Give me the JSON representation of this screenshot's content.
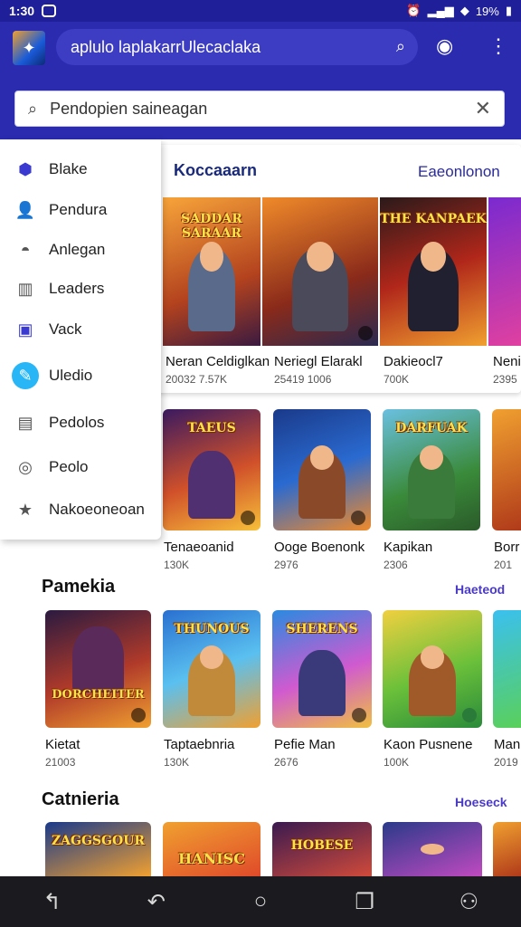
{
  "status": {
    "time": "1:30",
    "battery": "19%"
  },
  "app_bar": {
    "title": "aplulo laplakarrUlecaclaka"
  },
  "search": {
    "placeholder": "Pendopien saineagan"
  },
  "drawer": {
    "items": [
      {
        "label": "Blake",
        "icon": "badge-icon"
      },
      {
        "label": "Pendura",
        "icon": "person-icon"
      },
      {
        "label": "Anlegan",
        "icon": "controller-icon"
      },
      {
        "label": "Leaders",
        "icon": "book-icon"
      },
      {
        "label": "Vack",
        "icon": "window-icon"
      },
      {
        "label": "Uledio",
        "icon": "edit-icon"
      },
      {
        "label": "Pedolos",
        "icon": "library-icon"
      },
      {
        "label": "Peolo",
        "icon": "search-circle-icon"
      },
      {
        "label": "Nakoeoneoan",
        "icon": "star-icon"
      }
    ]
  },
  "featured": {
    "title": "Koccaaarn",
    "link": "Eaeonlonon",
    "cards": [
      {
        "name": "Neran Celdiglkan",
        "meta": "20032 7.57K",
        "art": "SADDAR SARAAR"
      },
      {
        "name": "Neriegl Elarakl",
        "meta": "25419 1006",
        "art": ""
      },
      {
        "name": "Dakieocl7",
        "meta": "700K",
        "art": "THE KANPAEK"
      },
      {
        "name": "Neni",
        "meta": "2395",
        "art": ""
      }
    ]
  },
  "row2": {
    "cards": [
      {
        "name": "Tenaeoanid",
        "meta": "130K",
        "art": "TAEUS"
      },
      {
        "name": "Ooge Boenonk",
        "meta": "2976",
        "art": ""
      },
      {
        "name": "Kapikan",
        "meta": "2306",
        "art": "DARFUAK"
      },
      {
        "name": "Borr",
        "meta": "201",
        "art": ""
      }
    ]
  },
  "pamekia": {
    "title": "Pamekia",
    "link": "Haeteod",
    "cards": [
      {
        "name": "Kietat",
        "meta": "21003",
        "art": "DORCHEITER"
      },
      {
        "name": "Taptaebnria",
        "meta": "130K",
        "art": "THUNOUS"
      },
      {
        "name": "Pefie Man",
        "meta": "2676",
        "art": "SHERENS"
      },
      {
        "name": "Kaon Pusnene",
        "meta": "100K",
        "art": ""
      },
      {
        "name": "Mani",
        "meta": "2019",
        "art": ""
      }
    ]
  },
  "catnieria": {
    "title": "Catnieria",
    "link": "Hoeseck",
    "cards": [
      {
        "art": "ZAGGSGOUR"
      },
      {
        "art": "HANISC"
      },
      {
        "art": "HOBESE"
      },
      {
        "art": ""
      },
      {
        "art": ""
      }
    ]
  },
  "colors": {
    "primary": "#2b2bb0",
    "accent": "#4a3ac8",
    "active": "#28b6f6"
  }
}
